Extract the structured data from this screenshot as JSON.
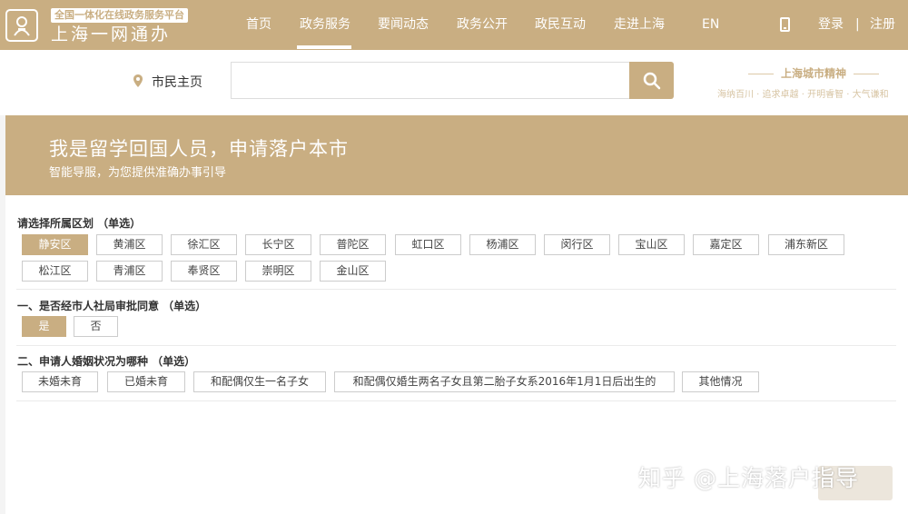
{
  "header": {
    "logo_sub": "全国一体化在线政务服务平台",
    "logo_main": "上海一网通办",
    "nav": [
      "首页",
      "政务服务",
      "要闻动态",
      "政务公开",
      "政民互动",
      "走进上海",
      "EN"
    ],
    "active_nav": "政务服务",
    "login": "登录",
    "separator": "|",
    "register": "注册"
  },
  "search": {
    "home_label": "市民主页",
    "placeholder": "",
    "spirit_title": "上海城市精神",
    "spirit_sub": "海纳百川 · 追求卓越 · 开明睿智 · 大气谦和"
  },
  "banner": {
    "title": "我是留学回国人员，申请落户本市",
    "subtitle": "智能导服，为您提供准确办事引导"
  },
  "questions": [
    {
      "title": "请选择所属区划 （单选）",
      "options": [
        "静安区",
        "黄浦区",
        "徐汇区",
        "长宁区",
        "普陀区",
        "虹口区",
        "杨浦区",
        "闵行区",
        "宝山区",
        "嘉定区",
        "浦东新区",
        "松江区",
        "青浦区",
        "奉贤区",
        "崇明区",
        "金山区"
      ],
      "selected": "静安区"
    },
    {
      "title": "一、是否经市人社局审批同意 （单选）",
      "options": [
        "是",
        "否"
      ],
      "selected": "是"
    },
    {
      "title": "二、申请人婚姻状况为哪种 （单选）",
      "options": [
        "未婚未育",
        "已婚未育",
        "和配偶仅生一名子女",
        "和配偶仅婚生两名子女且第二胎子女系2016年1月1日后出生的",
        "其他情况"
      ],
      "selected": null
    }
  ],
  "watermark": "知乎 @上海落户指导",
  "colors": {
    "brand": "#c9ae82",
    "white": "#ffffff"
  }
}
